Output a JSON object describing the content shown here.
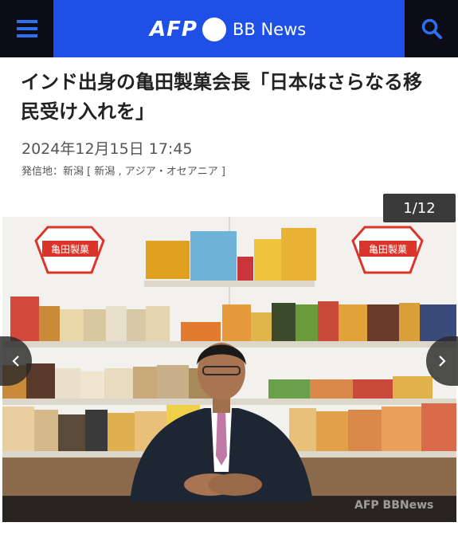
{
  "header": {
    "brand_afp": "AFP",
    "brand_bb": "BB News",
    "menu_icon": "hamburger-menu-icon",
    "search_icon": "search-icon",
    "colors": {
      "bar": "#1e4fe6",
      "sides": "#0c0c16"
    }
  },
  "article": {
    "title": "インド出身の亀田製菓会長「日本はさらなる移民受け入れを」",
    "date": "2024年12月15日 17:45",
    "dateline": "発信地：新潟 [ 新潟 , アジア・オセアニア ]"
  },
  "gallery": {
    "counter": "1/12",
    "prev_icon": "chevron-left-icon",
    "next_icon": "chevron-right-icon",
    "sign_text": "亀田製菓",
    "watermark": "AFP BBNews"
  }
}
